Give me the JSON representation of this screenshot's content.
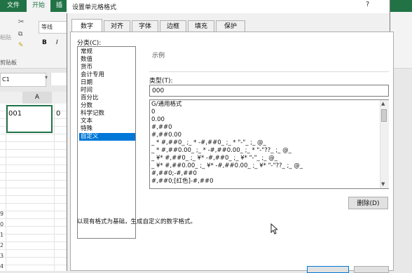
{
  "excel": {
    "tabs": [
      "文件",
      "开始",
      "插"
    ],
    "paste_label": "粘贴",
    "clipboard_group": "剪贴板",
    "font_name": "等线",
    "bold": "B",
    "italic": "I",
    "name_box": "C1",
    "column_header": "A",
    "cell_a1": "001",
    "cell_b1": "0",
    "row_numbers": [
      "9",
      "0",
      "1",
      "2",
      "3",
      "4"
    ]
  },
  "dialog": {
    "title": "设置单元格格式",
    "help": "?",
    "tabs": [
      "数字",
      "对齐",
      "字体",
      "边框",
      "填充",
      "保护"
    ],
    "active_tab": "数字",
    "category_label": "分类(C):",
    "categories": [
      "常规",
      "数值",
      "货币",
      "会计专用",
      "日期",
      "时间",
      "百分比",
      "分数",
      "科学记数",
      "文本",
      "特殊",
      "自定义"
    ],
    "selected_category": "自定义",
    "sample_label": "示例",
    "type_label": "类型(T):",
    "type_value": "000",
    "formats": [
      "G/通用格式",
      "0",
      "0.00",
      "#,##0",
      "#,##0.00",
      "_ * #,##0_ ;_ * -#,##0_ ;_ * \"-\"_ ;_ @_",
      "_ * #,##0.00_ ;_ * -#,##0.00_ ;_ * \"-\"??_ ;_ @_",
      "_ ¥* #,##0_ ;_ ¥* -#,##0_ ;_ ¥* \"-\"_ ;_ @_",
      "_ ¥* #,##0.00_ ;_ ¥* -#,##0.00_ ;_ ¥* \"-\"??_ ;_ @_",
      "#,##0;-#,##0",
      "#,##0;[红色]-#,##0"
    ],
    "delete_button": "删除(D)",
    "description": "以现有格式为基础，生成自定义的数字格式。"
  },
  "colors": {
    "excel_green": "#217346",
    "selection_blue": "#0078d7"
  },
  "icons": [
    "scissors-icon",
    "copy-icon",
    "format-painter-icon",
    "mouse-cursor-icon"
  ]
}
